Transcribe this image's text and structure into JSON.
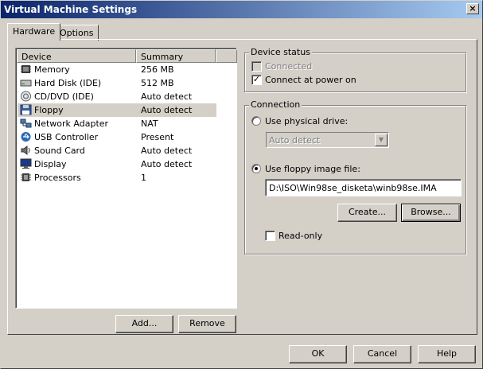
{
  "window": {
    "title": "Virtual Machine Settings",
    "close_glyph": "×"
  },
  "tabs": [
    {
      "label": "Hardware",
      "active": true
    },
    {
      "label": "Options",
      "active": false
    }
  ],
  "device_list": {
    "columns": [
      "Device",
      "Summary"
    ],
    "rows": [
      {
        "name": "Memory",
        "summary": "256 MB",
        "icon": "memory-icon",
        "selected": false
      },
      {
        "name": "Hard Disk (IDE)",
        "summary": "512 MB",
        "icon": "hard-disk-icon",
        "selected": false
      },
      {
        "name": "CD/DVD (IDE)",
        "summary": "Auto detect",
        "icon": "cd-dvd-icon",
        "selected": false
      },
      {
        "name": "Floppy",
        "summary": "Auto detect",
        "icon": "floppy-icon",
        "selected": true
      },
      {
        "name": "Network Adapter",
        "summary": "NAT",
        "icon": "network-adapter-icon",
        "selected": false
      },
      {
        "name": "USB Controller",
        "summary": "Present",
        "icon": "usb-icon",
        "selected": false
      },
      {
        "name": "Sound Card",
        "summary": "Auto detect",
        "icon": "sound-card-icon",
        "selected": false
      },
      {
        "name": "Display",
        "summary": "Auto detect",
        "icon": "display-icon",
        "selected": false
      },
      {
        "name": "Processors",
        "summary": "1",
        "icon": "processor-icon",
        "selected": false
      }
    ]
  },
  "list_buttons": {
    "add": "Add...",
    "remove": "Remove"
  },
  "device_status": {
    "title": "Device status",
    "connected": {
      "label": "Connected",
      "checked": false,
      "enabled": false
    },
    "connect_at_power_on": {
      "label": "Connect at power on",
      "checked": true,
      "enabled": true
    }
  },
  "connection": {
    "title": "Connection",
    "use_physical_drive": {
      "label": "Use physical drive:",
      "selected": false
    },
    "physical_drive_select": {
      "value": "Auto detect",
      "enabled": false
    },
    "use_floppy_image": {
      "label": "Use floppy image file:",
      "selected": true
    },
    "image_path": "D:\\ISO\\Win98se_disketa\\winb98se.IMA",
    "create_label": "Create...",
    "browse_label": "Browse...",
    "read_only": {
      "label": "Read-only",
      "checked": false
    }
  },
  "dialog_buttons": {
    "ok": "OK",
    "cancel": "Cancel",
    "help": "Help"
  },
  "colors": {
    "title_start": "#0a246a",
    "title_end": "#a6caf0",
    "face": "#d4d0c8"
  }
}
